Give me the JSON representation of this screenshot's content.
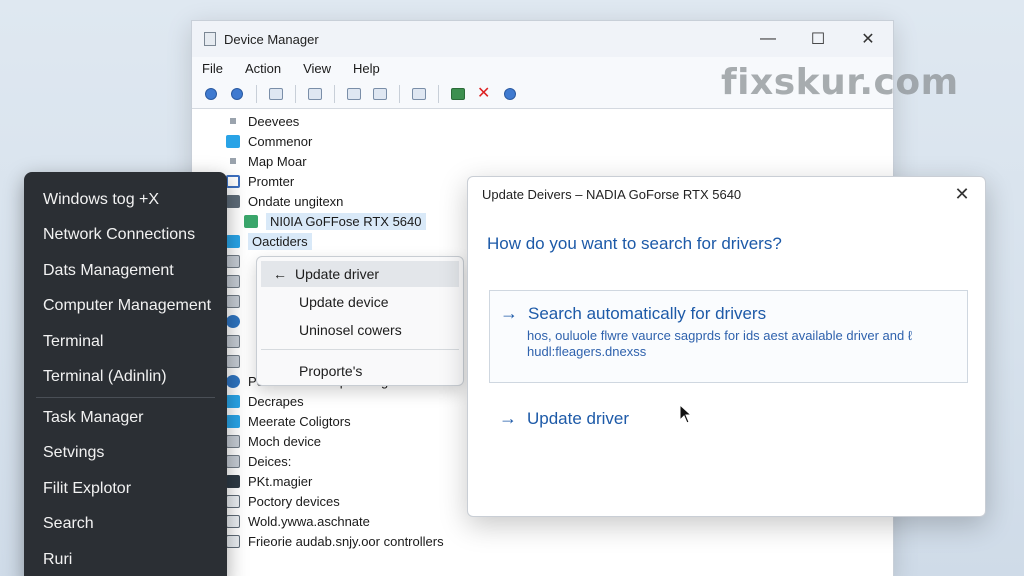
{
  "device_manager": {
    "title": "Device Manager",
    "menu": [
      "File",
      "Action",
      "View",
      "Help"
    ],
    "tree": [
      {
        "label": "Deevees",
        "icon": "bullet"
      },
      {
        "label": "Commenor",
        "icon": "blue-square"
      },
      {
        "label": "Map Moar",
        "icon": "bullet"
      },
      {
        "label": "Promter",
        "icon": "monitor-icon"
      },
      {
        "label": "Ondate ungitexn",
        "icon": "gray-square"
      },
      {
        "label": "NI0IA GoFFose RTX 5640",
        "icon": "green-card",
        "indent": true
      },
      {
        "label": "Oactiders",
        "icon": "blue-square",
        "selected": true
      },
      {
        "label": "Ponermedit the poviding devices",
        "icon": "globe-icon"
      },
      {
        "label": "Decrapes",
        "icon": "blue-square"
      },
      {
        "label": "Meerate Coligtors",
        "icon": "blue-square"
      },
      {
        "label": "Moch device",
        "icon": "disk-icon"
      },
      {
        "label": "Deices:",
        "icon": "disk-icon"
      },
      {
        "label": "PKt.magier",
        "icon": "chip-icon"
      },
      {
        "label": "Poctory devices",
        "icon": "card-icon"
      },
      {
        "label": "Wold.ywwa.aschnate",
        "icon": "card-icon"
      },
      {
        "label": "Frieorie audab.snjy.oor controllers",
        "icon": "card-icon"
      }
    ]
  },
  "context_menu": {
    "items": [
      "Update driver",
      "Update device",
      "Uninosel cowers"
    ],
    "after_separator": "Proporte's"
  },
  "winx_menu": {
    "items": [
      "Windows tog +X",
      "Network Connections",
      "Dats Management",
      "Computer Management",
      "Terminal",
      "Terminal (Adinlin)",
      "Task Manager",
      "Setvings",
      "Filit Explotor",
      "Search",
      "Ruri"
    ]
  },
  "update_dialog": {
    "title": "Update Deivers – NADIA GoForse RTX 5640",
    "question": "How do you want to search for drivers?",
    "option_title": "Search automatically for drivers",
    "option_desc": "hos, ouluole flwre vaurce sagprds for ids aest available driver and ℓ hudl:fleagers.dnexss",
    "update_link": "Update driver"
  },
  "watermark": "fixskur.com"
}
